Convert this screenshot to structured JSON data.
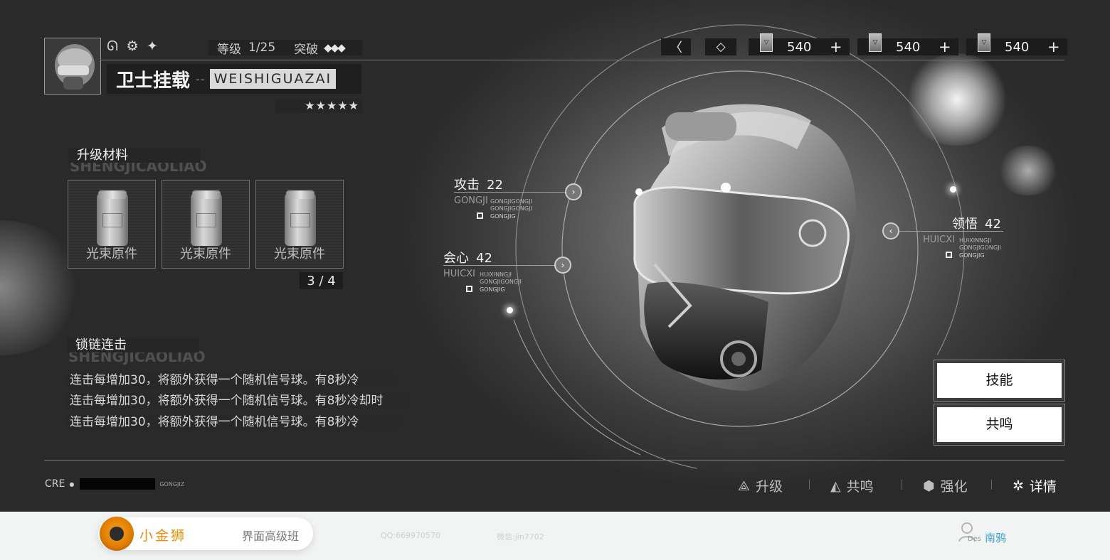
{
  "header": {
    "badges": [
      "swirl-icon",
      "gear-icon",
      "star-burst-icon"
    ],
    "level_label": "等级",
    "level_value": "1/25",
    "breakthrough_label": "突破",
    "breakthrough_gems": "◆◆◆",
    "item_name": "卫士挂载",
    "name_separator": "--",
    "item_pinyin": "WEISHIGUAZAI",
    "stars": "★★★★★"
  },
  "currency": {
    "back_glyph": "〈",
    "diamond_glyph": "◇",
    "resources": [
      {
        "value": "540",
        "plus": "+"
      },
      {
        "value": "540",
        "plus": "+"
      },
      {
        "value": "540",
        "plus": "+"
      }
    ]
  },
  "materials": {
    "title": "升级材料",
    "title_ghost": "SHENGJICAOLIAO",
    "items": [
      {
        "name": "光束原件"
      },
      {
        "name": "光束原件"
      },
      {
        "name": "光束原件"
      }
    ],
    "count": "3 / 4"
  },
  "chain": {
    "title": "锁链连击",
    "title_ghost": "SHENGJICAOLIAO",
    "lines": [
      "连击每增加30，将额外获得一个随机信号球。有8秒冷",
      "连击每增加30，将额外获得一个随机信号球。有8秒冷却时",
      "连击每增加30，将额外获得一个随机信号球。有8秒冷"
    ]
  },
  "stats": {
    "attack": {
      "label": "攻击",
      "value": "22",
      "pinyin": "GONGJI",
      "sub": [
        "GONGJIGONGJI",
        "GONGJIGONGJI"
      ],
      "tag": "GONGJIG",
      "node": "›"
    },
    "crit": {
      "label": "会心",
      "value": "42",
      "pinyin": "HUICXI",
      "sub": [
        "HUIXINNGJI",
        "GONGJIGONGJI"
      ],
      "tag": "GONGJIG",
      "node": "›"
    },
    "insight": {
      "label": "领悟",
      "value": "42",
      "pinyin": "HUICXI",
      "sub": [
        "HUIXINNGJI",
        "GONGJIGONGJI"
      ],
      "tag": "GONGJIG",
      "node": "‹"
    }
  },
  "actions": {
    "skill": "技能",
    "resonate": "共鸣"
  },
  "footer": {
    "cre_label": "CRE",
    "cre_dot": "●",
    "cre_tag": "GONGJIZ",
    "tabs": [
      {
        "label": "升级",
        "icon": "triangle-icon"
      },
      {
        "label": "共鸣",
        "icon": "delta-icon"
      },
      {
        "label": "强化",
        "icon": "cube-icon"
      },
      {
        "label": "详情",
        "icon": "pinwheel-icon"
      }
    ]
  },
  "watermark": {
    "brand": "小金狮",
    "course": "界面高级班",
    "qq": "QQ:669970570",
    "wechat": "微信:jin7702",
    "des": "Des",
    "author": "南鸦"
  }
}
